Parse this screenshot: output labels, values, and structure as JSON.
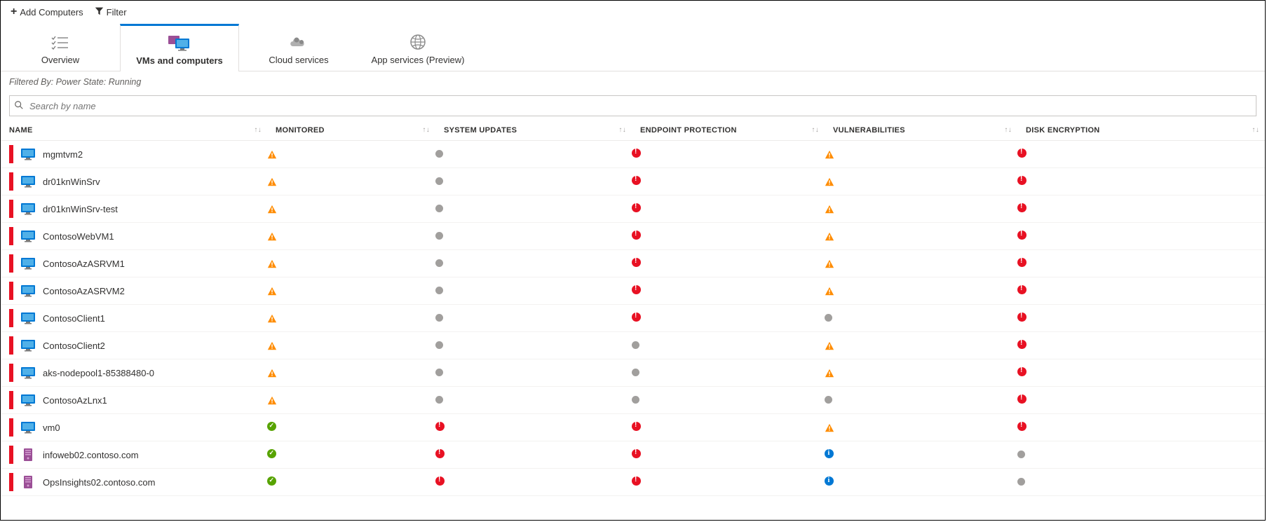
{
  "commands": {
    "add": "Add Computers",
    "filter": "Filter"
  },
  "tabs": [
    {
      "id": "overview",
      "label": "Overview",
      "icon": "list-check"
    },
    {
      "id": "vms",
      "label": "VMs and computers",
      "icon": "vm",
      "active": true
    },
    {
      "id": "cloud",
      "label": "Cloud services",
      "icon": "cloud-gears"
    },
    {
      "id": "app",
      "label": "App services (Preview)",
      "icon": "globe"
    }
  ],
  "filter_text": "Filtered By: Power State: Running",
  "search": {
    "placeholder": "Search by name"
  },
  "columns": {
    "name": "NAME",
    "monitored": "MONITORED",
    "updates": "SYSTEM UPDATES",
    "endpoint": "ENDPOINT PROTECTION",
    "vuln": "VULNERABILITIES",
    "disk": "DISK ENCRYPTION"
  },
  "rows": [
    {
      "name": "mgmtvm2",
      "res": "vm",
      "mon": "warn",
      "upd": "gray",
      "ep": "err",
      "vul": "warn",
      "de": "err"
    },
    {
      "name": "dr01knWinSrv",
      "res": "vm",
      "mon": "warn",
      "upd": "gray",
      "ep": "err",
      "vul": "warn",
      "de": "err"
    },
    {
      "name": "dr01knWinSrv-test",
      "res": "vm",
      "mon": "warn",
      "upd": "gray",
      "ep": "err",
      "vul": "warn",
      "de": "err"
    },
    {
      "name": "ContosoWebVM1",
      "res": "vm",
      "mon": "warn",
      "upd": "gray",
      "ep": "err",
      "vul": "warn",
      "de": "err"
    },
    {
      "name": "ContosoAzASRVM1",
      "res": "vm",
      "mon": "warn",
      "upd": "gray",
      "ep": "err",
      "vul": "warn",
      "de": "err"
    },
    {
      "name": "ContosoAzASRVM2",
      "res": "vm",
      "mon": "warn",
      "upd": "gray",
      "ep": "err",
      "vul": "warn",
      "de": "err"
    },
    {
      "name": "ContosoClient1",
      "res": "vm",
      "mon": "warn",
      "upd": "gray",
      "ep": "err",
      "vul": "gray",
      "de": "err"
    },
    {
      "name": "ContosoClient2",
      "res": "vm",
      "mon": "warn",
      "upd": "gray",
      "ep": "gray",
      "vul": "warn",
      "de": "err"
    },
    {
      "name": "aks-nodepool1-85388480-0",
      "res": "vm",
      "mon": "warn",
      "upd": "gray",
      "ep": "gray",
      "vul": "warn",
      "de": "err"
    },
    {
      "name": "ContosoAzLnx1",
      "res": "vm",
      "mon": "warn",
      "upd": "gray",
      "ep": "gray",
      "vul": "gray",
      "de": "err"
    },
    {
      "name": "vm0",
      "res": "vm",
      "mon": "ok",
      "upd": "err",
      "ep": "err",
      "vul": "warn",
      "de": "err"
    },
    {
      "name": "infoweb02.contoso.com",
      "res": "server",
      "mon": "ok",
      "upd": "err",
      "ep": "err",
      "vul": "info",
      "de": "gray"
    },
    {
      "name": "OpsInsights02.contoso.com",
      "res": "server",
      "mon": "ok",
      "upd": "err",
      "ep": "err",
      "vul": "info",
      "de": "gray"
    }
  ]
}
